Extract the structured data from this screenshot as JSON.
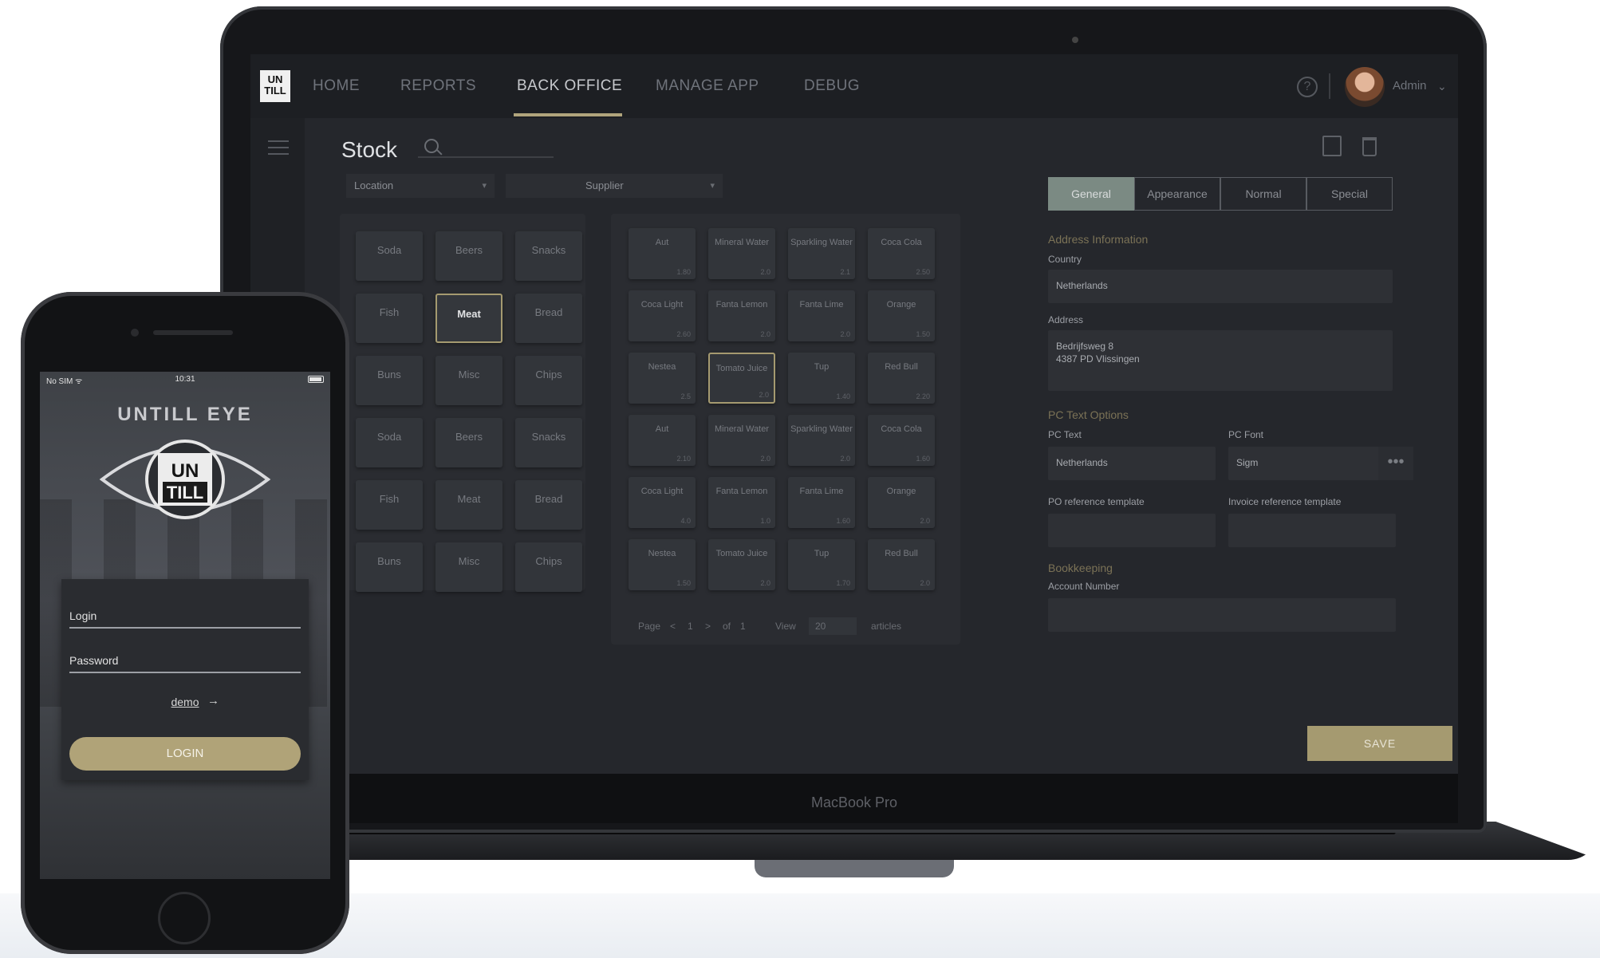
{
  "laptop": {
    "brand_label": "MacBook Pro",
    "nav": {
      "logo_text": "UN TILL",
      "items": [
        {
          "label": "HOME"
        },
        {
          "label": "REPORTS"
        },
        {
          "label": "BACK OFFICE",
          "active": true
        },
        {
          "label": "MANAGE APP"
        },
        {
          "label": "DEBUG"
        }
      ],
      "help_icon": "?",
      "user_name": "Admin",
      "user_chevron": "⌄"
    },
    "page": {
      "title": "Stock",
      "search_placeholder": ""
    },
    "filters": {
      "location": "Location",
      "supplier": "Supplier"
    },
    "groups": [
      "Soda",
      "Beers",
      "Snacks",
      "Fish",
      "Meat",
      "Bread",
      "Buns",
      "Misc",
      "Chips",
      "Soda",
      "Beers",
      "Snacks",
      "Fish",
      "Meat",
      "Bread",
      "Buns",
      "Misc",
      "Chips"
    ],
    "selected_group": "Meat",
    "products": [
      {
        "name": "Aut",
        "price": "1.80"
      },
      {
        "name": "Mineral Water",
        "price": "2.0"
      },
      {
        "name": "Sparkling Water",
        "price": "2.1"
      },
      {
        "name": "Coca Cola",
        "price": "2.50"
      },
      {
        "name": "Coca Light",
        "price": "2.60"
      },
      {
        "name": "Fanta Lemon",
        "price": "2.0"
      },
      {
        "name": "Fanta Lime",
        "price": "2.0"
      },
      {
        "name": "Orange",
        "price": "1.50"
      },
      {
        "name": "Nestea",
        "price": "2.5"
      },
      {
        "name": "Tomato Juice",
        "price": "2.0"
      },
      {
        "name": "Tup",
        "price": "1.40"
      },
      {
        "name": "Red Bull",
        "price": "2.20"
      },
      {
        "name": "Aut",
        "price": "2.10"
      },
      {
        "name": "Mineral Water",
        "price": "2.0"
      },
      {
        "name": "Sparkling Water",
        "price": "2.0"
      },
      {
        "name": "Coca Cola",
        "price": "1.60"
      },
      {
        "name": "Coca Light",
        "price": "4.0"
      },
      {
        "name": "Fanta Lemon",
        "price": "1.0"
      },
      {
        "name": "Fanta Lime",
        "price": "1.60"
      },
      {
        "name": "Orange",
        "price": "2.0"
      },
      {
        "name": "Nestea",
        "price": "1.50"
      },
      {
        "name": "Tomato Juice",
        "price": "2.0"
      },
      {
        "name": "Tup",
        "price": "1.70"
      },
      {
        "name": "Red Bull",
        "price": "2.0"
      }
    ],
    "selected_product": "Tomato Juice",
    "pager": {
      "page_label": "Page",
      "prev": "<",
      "page_current": "1",
      "next": ">",
      "of_label": "of",
      "page_total": "1",
      "view_label": "View",
      "view_value": "20",
      "articles_label": "articles"
    },
    "form": {
      "tabs": [
        "General",
        "Appearance",
        "Normal",
        "Special"
      ],
      "active_tab": "General",
      "address_section": "Address Information",
      "country_label": "Country",
      "country_value": "Netherlands",
      "address_label": "Address",
      "address_line1": "Bedrijfsweg 8",
      "address_line2": "4387 PD Vlissingen",
      "pc_section": "PC Text Options",
      "pc_text_label": "PC Text",
      "pc_text_value": "Netherlands",
      "pc_font_label": "PC Font",
      "pc_font_value": "Sigm",
      "more_label": "•••",
      "po_ref_label": "PO reference template",
      "po_ref_value": "",
      "invoice_ref_label": "Invoice reference template",
      "invoice_ref_value": "",
      "bookkeeping_section": "Bookkeeping",
      "account_label": "Account Number",
      "account_value": "",
      "save_label": "SAVE"
    },
    "colors": {
      "accent_gold": "#a59a70",
      "active_tab": "#7b8a83",
      "background": "#25272c"
    }
  },
  "phone": {
    "status": {
      "carrier": "No SIM ᯤ",
      "time": "10:31"
    },
    "app_title": "UNTILL EYE",
    "logo_text_top": "UN",
    "logo_text_bottom": "TILL",
    "login_label": "Login",
    "password_label": "Password",
    "demo_link": "demo",
    "demo_arrow": "→",
    "login_button": "LOGIN",
    "colors": {
      "button": "#b0a378"
    }
  }
}
